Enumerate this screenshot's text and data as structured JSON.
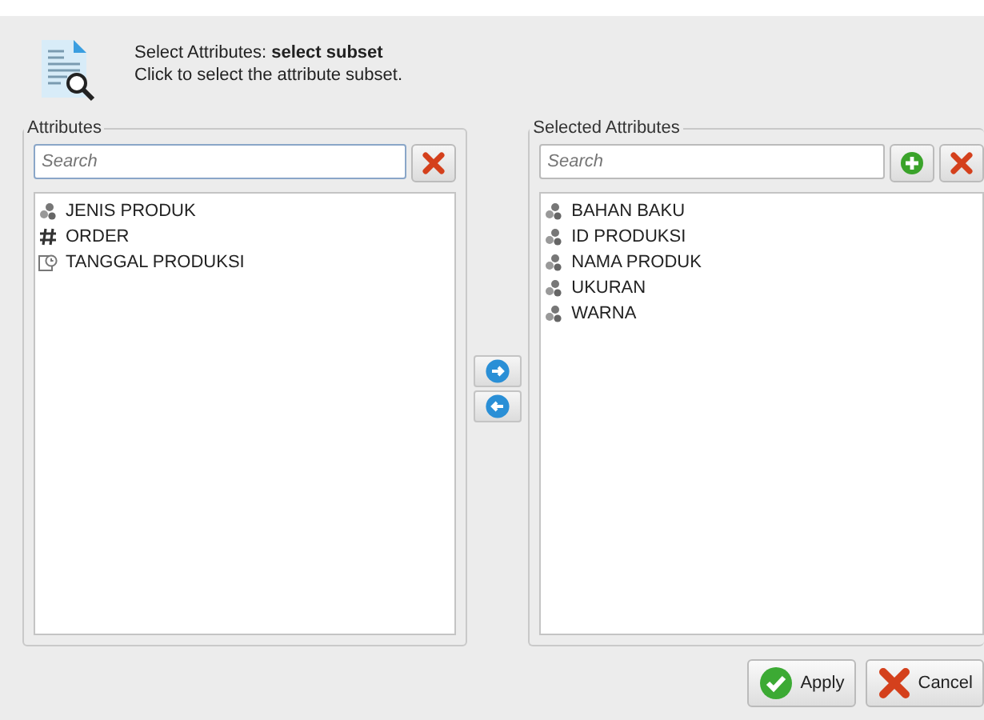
{
  "header": {
    "title_label": "Select Attributes: ",
    "title_value": "select subset",
    "subtitle": "Click to select the attribute subset."
  },
  "attributes": {
    "legend": "Attributes",
    "search": {
      "placeholder": "Search"
    },
    "items": [
      {
        "kind": "nominal",
        "label": "JENIS PRODUK"
      },
      {
        "kind": "numeric",
        "label": "ORDER"
      },
      {
        "kind": "date",
        "label": "TANGGAL PRODUKSI"
      }
    ]
  },
  "selected_attributes": {
    "legend": "Selected Attributes",
    "search": {
      "placeholder": "Search"
    },
    "items": [
      {
        "kind": "nominal",
        "label": "BAHAN BAKU"
      },
      {
        "kind": "nominal",
        "label": "ID PRODUKSI"
      },
      {
        "kind": "nominal",
        "label": "NAMA PRODUK"
      },
      {
        "kind": "nominal",
        "label": "UKURAN"
      },
      {
        "kind": "nominal",
        "label": "WARNA"
      }
    ]
  },
  "buttons": [
    {
      "kind": "apply",
      "label": "Apply"
    },
    {
      "kind": "cancel",
      "label": "Cancel"
    }
  ]
}
